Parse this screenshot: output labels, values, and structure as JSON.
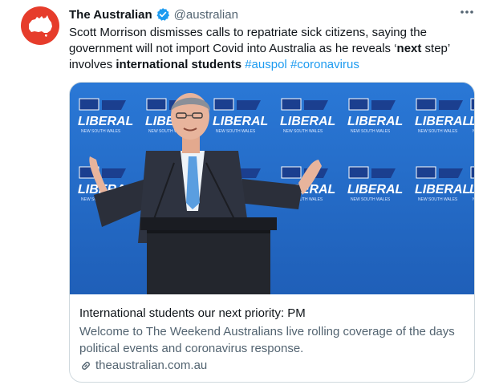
{
  "account": {
    "name": "The Australian",
    "handle": "@australian",
    "avatar_color": "#e63c2b",
    "verified_color": "#1d9bf0"
  },
  "tweet": {
    "text_parts": [
      "Scott Morrison dismisses calls to repatriate sick citizens, saying the government will not import Covid into Australia as he reveals ‘",
      "next",
      " step’ involves ",
      "international students",
      " ",
      "#auspol",
      " ",
      "#coronavirus"
    ]
  },
  "card": {
    "image_signs": [
      "LIBERAL",
      "LIBERAL",
      "LIBERAL",
      "LIBERAL",
      "LIBERAL",
      "LIBERAL"
    ],
    "image_subtext": "NEW SOUTH WALES",
    "title": "International students our next priority: PM",
    "description": "Welcome to The Weekend Australians live rolling coverage of the days political events and coronavirus response.",
    "domain": "theaustralian.com.au"
  },
  "icons": {
    "more": "more-horizontal-icon",
    "verified": "verified-badge-icon",
    "link": "link-icon"
  },
  "colors": {
    "link": "#1d9bf0",
    "secondary_text": "#536471",
    "backdrop_blue": "#2f7bd8"
  }
}
